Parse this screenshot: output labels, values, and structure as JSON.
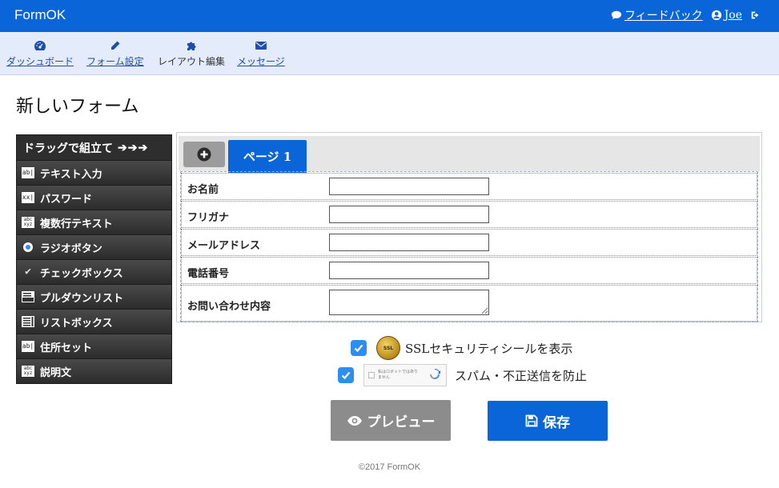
{
  "app": {
    "brand": "FormOK"
  },
  "header": {
    "feedback_label": "フィードバック",
    "user_name": "Joe"
  },
  "subnav": {
    "items": [
      {
        "label": "ダッシュボード",
        "icon": "dashboard-icon"
      },
      {
        "label": "フォーム設定",
        "icon": "pencil-icon"
      },
      {
        "label": "レイアウト編集",
        "icon": "puzzle-icon",
        "current": true
      },
      {
        "label": "メッセージ",
        "icon": "envelope-icon"
      }
    ]
  },
  "page": {
    "title": "新しいフォーム"
  },
  "palette": {
    "heading": "ドラッグで組立て",
    "heading_arrows": "➔➔➔",
    "items": [
      {
        "label": "テキスト入力",
        "icon": "ab|",
        "icon_name": "text-input-icon"
      },
      {
        "label": "パスワード",
        "icon": "xx|",
        "icon_name": "password-icon"
      },
      {
        "label": "複数行テキスト",
        "icon": "abc xyz",
        "icon_name": "textarea-icon"
      },
      {
        "label": "ラジオボタン",
        "icon": "radio",
        "icon_name": "radio-icon"
      },
      {
        "label": "チェックボックス",
        "icon": "✔",
        "icon_name": "checkbox-icon"
      },
      {
        "label": "プルダウンリスト",
        "icon": "select",
        "icon_name": "dropdown-icon"
      },
      {
        "label": "リストボックス",
        "icon": "list",
        "icon_name": "listbox-icon"
      },
      {
        "label": "住所セット",
        "icon": "ab|",
        "icon_name": "address-icon"
      },
      {
        "label": "説明文",
        "icon": "abc xyz",
        "icon_name": "description-icon"
      }
    ]
  },
  "form": {
    "tab_label": "ページ 1",
    "fields": [
      {
        "label": "お名前",
        "value": "",
        "type": "text"
      },
      {
        "label": "フリガナ",
        "value": "",
        "type": "text"
      },
      {
        "label": "メールアドレス",
        "value": "",
        "type": "text"
      },
      {
        "label": "電話番号",
        "value": "",
        "type": "text"
      },
      {
        "label": "お問い合わせ内容",
        "value": "",
        "type": "textarea"
      }
    ]
  },
  "options": {
    "ssl_label": "SSLセキュリティシールを表示",
    "ssl_checked": true,
    "ssl_seal_text": "SSL",
    "spam_label": "スパム・不正送信を防止",
    "spam_checked": true,
    "recaptcha_text": "私はロボットではありません"
  },
  "actions": {
    "preview_label": "プレビュー",
    "save_label": "保存"
  },
  "footer": {
    "copyright": "©2017 FormOK"
  },
  "colors": {
    "primary": "#0a66d8",
    "subnav_bg": "#e4ecfb",
    "palette_bg": "#2e2e2e",
    "preview_btn": "#8c8c8c",
    "checkbox": "#2d8ef0"
  }
}
